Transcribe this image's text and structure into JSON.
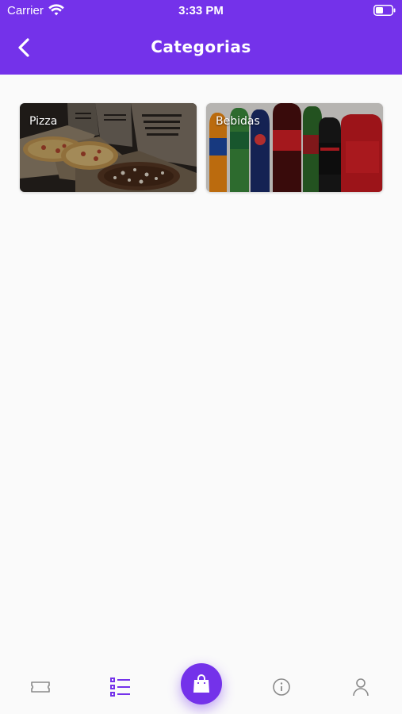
{
  "status_bar": {
    "carrier": "Carrier",
    "time": "3:33 PM",
    "wifi_icon": "wifi-icon",
    "battery_icon": "battery-icon"
  },
  "header": {
    "title": "Categorias",
    "back_icon": "chevron-left-icon"
  },
  "categories": [
    {
      "label": "Pizza",
      "image": "pizza-boxes-photo"
    },
    {
      "label": "Bebidas",
      "image": "soda-bottles-photo"
    }
  ],
  "tabbar": {
    "items": [
      {
        "icon": "ticket-icon",
        "active": false
      },
      {
        "icon": "list-icon",
        "active": true
      },
      {
        "icon": "shopping-bag-icon",
        "active": false,
        "primary": true
      },
      {
        "icon": "info-icon",
        "active": false
      },
      {
        "icon": "user-icon",
        "active": false
      }
    ]
  },
  "colors": {
    "primary": "#7432ea",
    "background": "#fafafa",
    "inactive_icon": "#8a8a8a"
  }
}
